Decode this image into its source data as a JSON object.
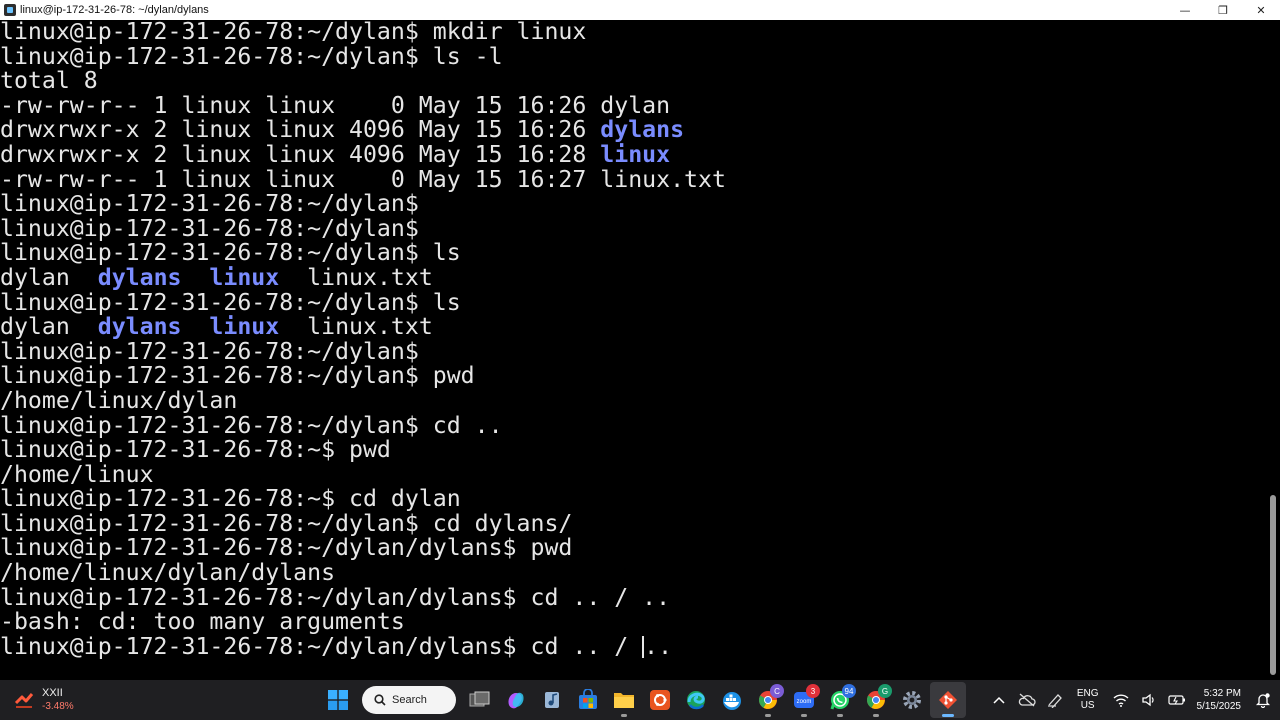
{
  "window": {
    "title": "linux@ip-172-31-26-78: ~/dylan/dylans",
    "minimize_glyph": "—",
    "maximize_glyph": "❐",
    "close_glyph": "✕"
  },
  "terminal": {
    "lines": [
      {
        "segments": [
          {
            "text": "linux@ip-172-31-26-78:~/dylan$ mkdir linux",
            "dir": false
          }
        ]
      },
      {
        "segments": [
          {
            "text": "linux@ip-172-31-26-78:~/dylan$ ls -l",
            "dir": false
          }
        ]
      },
      {
        "segments": [
          {
            "text": "total 8",
            "dir": false
          }
        ]
      },
      {
        "segments": [
          {
            "text": "-rw-rw-r-- 1 linux linux    0 May 15 16:26 dylan",
            "dir": false
          }
        ]
      },
      {
        "segments": [
          {
            "text": "drwxrwxr-x 2 linux linux 4096 May 15 16:26 ",
            "dir": false
          },
          {
            "text": "dylans",
            "dir": true
          }
        ]
      },
      {
        "segments": [
          {
            "text": "drwxrwxr-x 2 linux linux 4096 May 15 16:28 ",
            "dir": false
          },
          {
            "text": "linux",
            "dir": true
          }
        ]
      },
      {
        "segments": [
          {
            "text": "-rw-rw-r-- 1 linux linux    0 May 15 16:27 linux.txt",
            "dir": false
          }
        ]
      },
      {
        "segments": [
          {
            "text": "linux@ip-172-31-26-78:~/dylan$",
            "dir": false
          }
        ]
      },
      {
        "segments": [
          {
            "text": "linux@ip-172-31-26-78:~/dylan$",
            "dir": false
          }
        ]
      },
      {
        "segments": [
          {
            "text": "linux@ip-172-31-26-78:~/dylan$ ls",
            "dir": false
          }
        ]
      },
      {
        "segments": [
          {
            "text": "dylan  ",
            "dir": false
          },
          {
            "text": "dylans",
            "dir": true
          },
          {
            "text": "  ",
            "dir": false
          },
          {
            "text": "linux",
            "dir": true
          },
          {
            "text": "  linux.txt",
            "dir": false
          }
        ]
      },
      {
        "segments": [
          {
            "text": "linux@ip-172-31-26-78:~/dylan$ ls",
            "dir": false
          }
        ]
      },
      {
        "segments": [
          {
            "text": "dylan  ",
            "dir": false
          },
          {
            "text": "dylans",
            "dir": true
          },
          {
            "text": "  ",
            "dir": false
          },
          {
            "text": "linux",
            "dir": true
          },
          {
            "text": "  linux.txt",
            "dir": false
          }
        ]
      },
      {
        "segments": [
          {
            "text": "linux@ip-172-31-26-78:~/dylan$",
            "dir": false
          }
        ]
      },
      {
        "segments": [
          {
            "text": "linux@ip-172-31-26-78:~/dylan$ pwd",
            "dir": false
          }
        ]
      },
      {
        "segments": [
          {
            "text": "/home/linux/dylan",
            "dir": false
          }
        ]
      },
      {
        "segments": [
          {
            "text": "linux@ip-172-31-26-78:~/dylan$ cd ..",
            "dir": false
          }
        ]
      },
      {
        "segments": [
          {
            "text": "linux@ip-172-31-26-78:~$ pwd",
            "dir": false
          }
        ]
      },
      {
        "segments": [
          {
            "text": "/home/linux",
            "dir": false
          }
        ]
      },
      {
        "segments": [
          {
            "text": "linux@ip-172-31-26-78:~$ cd dylan",
            "dir": false
          }
        ]
      },
      {
        "segments": [
          {
            "text": "linux@ip-172-31-26-78:~/dylan$ cd dylans/",
            "dir": false
          }
        ]
      },
      {
        "segments": [
          {
            "text": "linux@ip-172-31-26-78:~/dylan/dylans$ pwd",
            "dir": false
          }
        ]
      },
      {
        "segments": [
          {
            "text": "/home/linux/dylan/dylans",
            "dir": false
          }
        ]
      },
      {
        "segments": [
          {
            "text": "linux@ip-172-31-26-78:~/dylan/dylans$ cd .. / ..",
            "dir": false
          }
        ]
      },
      {
        "segments": [
          {
            "text": "-bash: cd: too many arguments",
            "dir": false
          }
        ]
      }
    ],
    "input_line": {
      "before_cursor": "linux@ip-172-31-26-78:~/dylan/dylans$ cd .. / ",
      "after_cursor": ".."
    }
  },
  "taskbar": {
    "widget": {
      "name": "XXII",
      "change": "-3.48%",
      "icon": "stock-chart-icon"
    },
    "search_label": "Search",
    "apps": [
      {
        "name": "start-button",
        "icon": "windows-logo-icon"
      },
      {
        "name": "search",
        "icon": "search-icon"
      },
      {
        "name": "task-view",
        "icon": "task-view-icon"
      },
      {
        "name": "copilot",
        "icon": "copilot-icon"
      },
      {
        "name": "media-player",
        "icon": "music-icon"
      },
      {
        "name": "store",
        "icon": "store-icon"
      },
      {
        "name": "file-explorer",
        "icon": "folder-icon"
      },
      {
        "name": "ubuntu",
        "icon": "ubuntu-icon"
      },
      {
        "name": "edge",
        "icon": "edge-icon"
      },
      {
        "name": "docker",
        "icon": "docker-icon"
      },
      {
        "name": "chrome",
        "icon": "chrome-icon",
        "badge": "C"
      },
      {
        "name": "zoom",
        "icon": "zoom-icon",
        "badge": "3"
      },
      {
        "name": "whatsapp",
        "icon": "whatsapp-icon",
        "badge": "94"
      },
      {
        "name": "chrome-profile",
        "icon": "chrome-icon",
        "badge": "G"
      },
      {
        "name": "settings",
        "icon": "gear-icon"
      },
      {
        "name": "git-bash",
        "icon": "git-icon"
      }
    ],
    "tray": {
      "lang_top": "ENG",
      "lang_bottom": "US",
      "time": "5:32 PM",
      "date": "5/15/2025"
    }
  },
  "colors": {
    "terminal_bg": "#000000",
    "terminal_fg": "#e6e6e6",
    "directory": "#7a8cff",
    "taskbar_bg": "#1f1f22"
  }
}
